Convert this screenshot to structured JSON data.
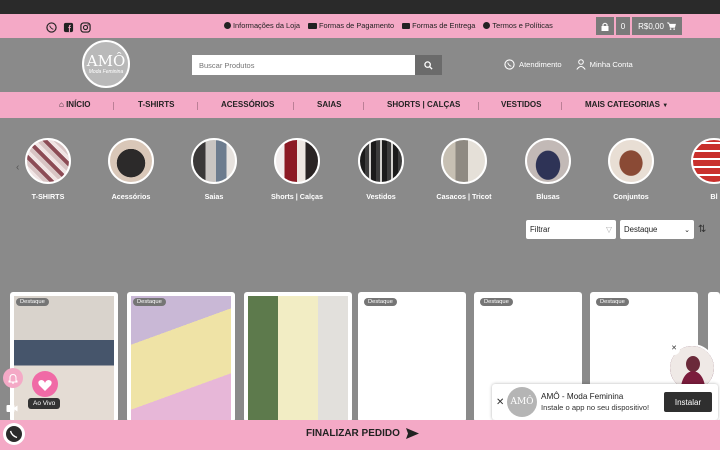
{
  "infobar": {
    "links": [
      {
        "label": "Informações da Loja",
        "icon": "info-icon"
      },
      {
        "label": "Formas de Pagamento",
        "icon": "credit-card-icon"
      },
      {
        "label": "Formas de Entrega",
        "icon": "truck-icon"
      },
      {
        "label": "Termos e Políticas",
        "icon": "gear-icon"
      }
    ],
    "social": [
      "whatsapp-icon",
      "facebook-icon",
      "instagram-icon"
    ]
  },
  "cart": {
    "count": "0",
    "price": "R$0,00"
  },
  "logo": {
    "line1": "AMÔ",
    "line2": "Moda Feminina"
  },
  "search": {
    "placeholder": "Buscar Produtos"
  },
  "header_links": {
    "atendimento": "Atendimento",
    "conta": "Minha Conta"
  },
  "nav": {
    "items": [
      "INÍCIO",
      "T-SHIRTS",
      "ACESSÓRIOS",
      "SAIAS",
      "SHORTS | CALÇAS",
      "VESTIDOS",
      "MAIS CATEGORIAS"
    ]
  },
  "categories": [
    "T-SHIRTS",
    "Acessórios",
    "Saias",
    "Shorts | Calças",
    "Vestidos",
    "Casacos | Tricot",
    "Blusas",
    "Conjuntos",
    "Bl"
  ],
  "filters": {
    "filter_label": "Filtrar",
    "sort_label": "Destaque"
  },
  "products": {
    "badge": "Destaque",
    "count_badges": 6
  },
  "live": {
    "label": "Ao Vivo"
  },
  "pwa": {
    "title": "AMÔ - Moda Feminina",
    "subtitle": "Instale o app no seu dispositivo!",
    "button": "Instalar"
  },
  "bottom": {
    "label": "FINALIZAR PEDIDO"
  },
  "colors": {
    "pink": "#f4a9c6",
    "gray": "#8a8a8a",
    "dark": "#2a2a2a"
  }
}
